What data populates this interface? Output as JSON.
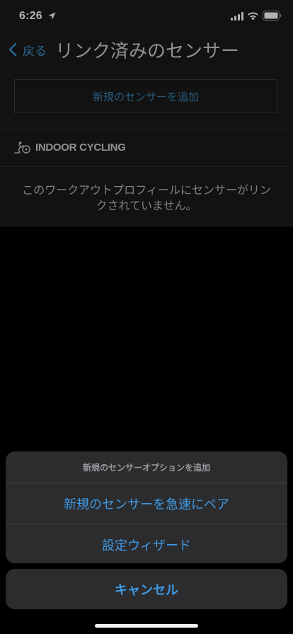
{
  "status_bar": {
    "time": "6:26"
  },
  "nav": {
    "back_label": "戻る",
    "title": "リンク済みのセンサー"
  },
  "content": {
    "add_sensor_label": "新規のセンサーを追加",
    "section_title": "INDOOR CYCLING",
    "empty_message": "このワークアウトプロフィールにセンサーがリンクされていません。"
  },
  "action_sheet": {
    "title": "新規のセンサーオプションを追加",
    "options": [
      {
        "label": "新規のセンサーを急速にペア"
      },
      {
        "label": "設定ウィザード"
      }
    ],
    "cancel_label": "キャンセル"
  },
  "icons": {
    "location": "location-arrow-icon",
    "signal": "cellular-signal-icon",
    "wifi": "wifi-icon",
    "battery": "battery-icon",
    "back": "chevron-left-icon",
    "section": "cycling-icon"
  },
  "colors": {
    "accent": "#3f9ae6",
    "link": "#3a93c9",
    "background": "#000000",
    "surface": "#1a1a1a",
    "sheet": "#2c2c2e"
  }
}
